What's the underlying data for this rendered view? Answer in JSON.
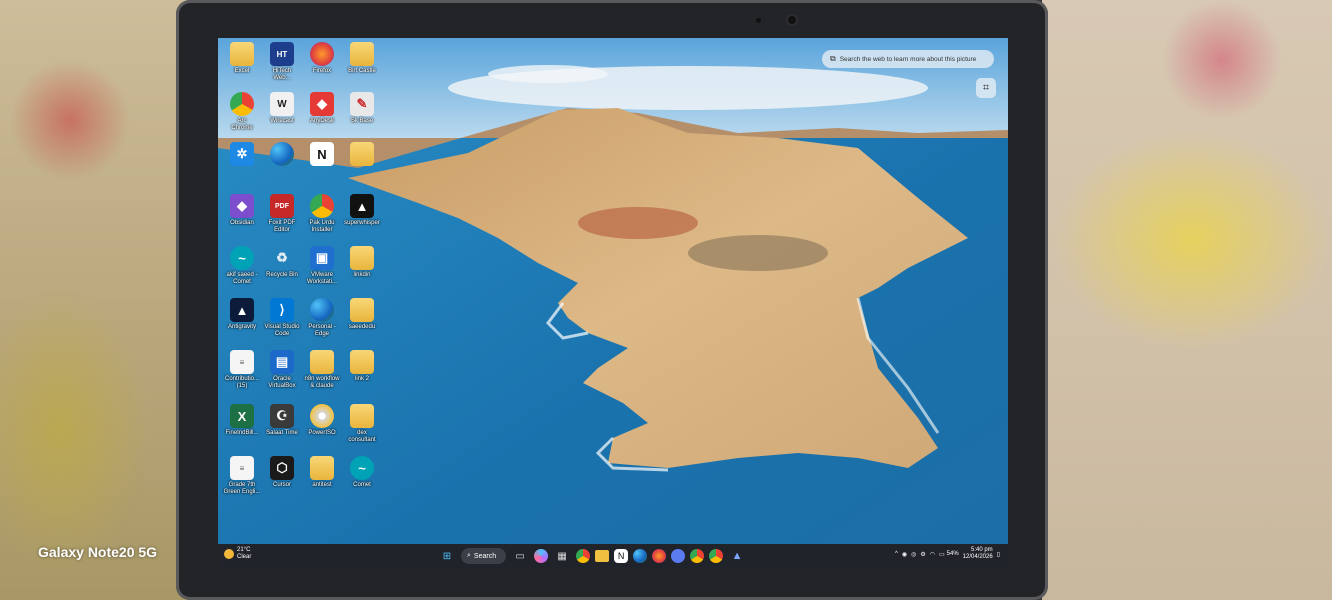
{
  "watermark": "Galaxy Note20 5G",
  "lens": {
    "tooltip": "Search the web to learn more about this picture"
  },
  "desktop_icons": [
    {
      "label": "Excel",
      "icon": "folder-icon"
    },
    {
      "label": "HiTech\nWeb...",
      "icon": "app-icon"
    },
    {
      "label": "Firefox",
      "icon": "firefox-icon"
    },
    {
      "label": "Birt Castle",
      "icon": "folder-icon"
    },
    {
      "label": "Arc\nChrome",
      "icon": "chrome-icon"
    },
    {
      "label": "Wirecast",
      "icon": "app-icon"
    },
    {
      "label": "AnyDesk",
      "icon": "anydesk-icon"
    },
    {
      "label": "Sk Base",
      "icon": "app-icon"
    },
    {
      "label": "",
      "icon": "gear-app-icon"
    },
    {
      "label": "",
      "icon": "edge-icon"
    },
    {
      "label": "",
      "icon": "notion-icon"
    },
    {
      "label": "",
      "icon": "folder-icon"
    },
    {
      "label": "Obsidian",
      "icon": "obsidian-icon"
    },
    {
      "label": "Foxit PDF\nEditor",
      "icon": "foxit-icon"
    },
    {
      "label": "Pak Urdu\nInstaller",
      "icon": "chrome-icon"
    },
    {
      "label": "superwhisper",
      "icon": "superwhisper-icon"
    },
    {
      "label": "akif saeed -\nComet",
      "icon": "comet-icon"
    },
    {
      "label": "Recycle Bin",
      "icon": "recycle-bin-icon"
    },
    {
      "label": "VMware\nWorkstati...",
      "icon": "vmware-icon"
    },
    {
      "label": "linkdin",
      "icon": "folder-icon"
    },
    {
      "label": "Antigravity",
      "icon": "antigravity-icon"
    },
    {
      "label": "Visual Studio\nCode",
      "icon": "vscode-icon"
    },
    {
      "label": "Personal -\nEdge",
      "icon": "edge-icon"
    },
    {
      "label": "saeededu",
      "icon": "folder-icon"
    },
    {
      "label": "Contributio...\n(15)",
      "icon": "document-icon"
    },
    {
      "label": "Oracle\nVirtualBox",
      "icon": "virtualbox-icon"
    },
    {
      "label": "n8n workflow\n& claude",
      "icon": "folder-icon"
    },
    {
      "label": "link 2",
      "icon": "folder-icon"
    },
    {
      "label": "FineIndBill...",
      "icon": "excel-icon"
    },
    {
      "label": "Salaat Time",
      "icon": "salaat-icon"
    },
    {
      "label": "PowerISO",
      "icon": "poweriso-icon"
    },
    {
      "label": "dex\nconsultant",
      "icon": "folder-icon"
    },
    {
      "label": "Grade 7th\nGreen Engli...",
      "icon": "document-icon"
    },
    {
      "label": "Cursor",
      "icon": "cursor-icon"
    },
    {
      "label": "antitest",
      "icon": "folder-icon"
    },
    {
      "label": "Comet",
      "icon": "comet-icon"
    }
  ],
  "taskbar": {
    "weather_temp": "21°C",
    "weather_desc": "Clear",
    "search_label": "Search",
    "pinned": [
      "widgets-icon",
      "copilot-icon",
      "store-icon",
      "chrome-icon",
      "file-explorer-icon",
      "notion-icon",
      "edge-icon",
      "firefox-icon",
      "comet-icon",
      "chrome-icon",
      "chrome-icon",
      "antigravity-icon"
    ],
    "battery": "54%",
    "time": "5:40 pm",
    "date": "12/04/2026"
  },
  "colors": {
    "taskbar": "#202329",
    "sea": "#1f7fb6",
    "sky": "#6fb4e4",
    "land": "#d9b57f"
  }
}
